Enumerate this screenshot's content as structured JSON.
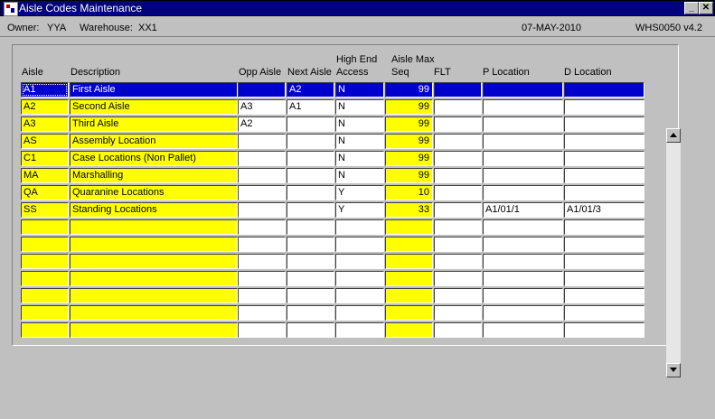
{
  "window": {
    "title": "Aisle Codes Maintenance",
    "minimize_glyph": "_",
    "close_glyph": "✕",
    "icon": "app-icon"
  },
  "header": {
    "owner_label": "Owner:",
    "owner": "YYA",
    "warehouse_label": "Warehouse:",
    "warehouse": "XX1",
    "date": "07-MAY-2010",
    "form_id": "WHS0050  v4.2"
  },
  "table": {
    "columns": {
      "aisle": "Aisle",
      "description": "Description",
      "opp_aisle": "Opp Aisle",
      "next_aisle": "Next Aisle",
      "high_end_1": "High End",
      "high_end_2": "Access",
      "aisle_max_1": "Aisle Max",
      "aisle_max_2": "Seq",
      "flt": "FLT",
      "p_location": "P Location",
      "d_location": "D Location"
    },
    "rows": [
      {
        "aisle": "A1",
        "description": "First Aisle",
        "opp_aisle": "",
        "next_aisle": "A2",
        "high_end": "N",
        "seq": "99",
        "flt": "",
        "p_location": "",
        "d_location": ""
      },
      {
        "aisle": "A2",
        "description": "Second Aisle",
        "opp_aisle": "A3",
        "next_aisle": "A1",
        "high_end": "N",
        "seq": "99",
        "flt": "",
        "p_location": "",
        "d_location": ""
      },
      {
        "aisle": "A3",
        "description": "Third Aisle",
        "opp_aisle": "A2",
        "next_aisle": "",
        "high_end": "N",
        "seq": "99",
        "flt": "",
        "p_location": "",
        "d_location": ""
      },
      {
        "aisle": "AS",
        "description": "Assembly Location",
        "opp_aisle": "",
        "next_aisle": "",
        "high_end": "N",
        "seq": "99",
        "flt": "",
        "p_location": "",
        "d_location": ""
      },
      {
        "aisle": "C1",
        "description": "Case Locations (Non Pallet)",
        "opp_aisle": "",
        "next_aisle": "",
        "high_end": "N",
        "seq": "99",
        "flt": "",
        "p_location": "",
        "d_location": ""
      },
      {
        "aisle": "MA",
        "description": "Marshalling",
        "opp_aisle": "",
        "next_aisle": "",
        "high_end": "N",
        "seq": "99",
        "flt": "",
        "p_location": "",
        "d_location": ""
      },
      {
        "aisle": "QA",
        "description": "Quaranine Locations",
        "opp_aisle": "",
        "next_aisle": "",
        "high_end": "Y",
        "seq": "10",
        "flt": "",
        "p_location": "",
        "d_location": ""
      },
      {
        "aisle": "SS",
        "description": "Standing Locations",
        "opp_aisle": "",
        "next_aisle": "",
        "high_end": "Y",
        "seq": "33",
        "flt": "",
        "p_location": "A1/01/1",
        "d_location": "A1/01/3"
      },
      {
        "aisle": "",
        "description": "",
        "opp_aisle": "",
        "next_aisle": "",
        "high_end": "",
        "seq": "",
        "flt": "",
        "p_location": "",
        "d_location": ""
      },
      {
        "aisle": "",
        "description": "",
        "opp_aisle": "",
        "next_aisle": "",
        "high_end": "",
        "seq": "",
        "flt": "",
        "p_location": "",
        "d_location": ""
      },
      {
        "aisle": "",
        "description": "",
        "opp_aisle": "",
        "next_aisle": "",
        "high_end": "",
        "seq": "",
        "flt": "",
        "p_location": "",
        "d_location": ""
      },
      {
        "aisle": "",
        "description": "",
        "opp_aisle": "",
        "next_aisle": "",
        "high_end": "",
        "seq": "",
        "flt": "",
        "p_location": "",
        "d_location": ""
      },
      {
        "aisle": "",
        "description": "",
        "opp_aisle": "",
        "next_aisle": "",
        "high_end": "",
        "seq": "",
        "flt": "",
        "p_location": "",
        "d_location": ""
      },
      {
        "aisle": "",
        "description": "",
        "opp_aisle": "",
        "next_aisle": "",
        "high_end": "",
        "seq": "",
        "flt": "",
        "p_location": "",
        "d_location": ""
      },
      {
        "aisle": "",
        "description": "",
        "opp_aisle": "",
        "next_aisle": "",
        "high_end": "",
        "seq": "",
        "flt": "",
        "p_location": "",
        "d_location": ""
      }
    ],
    "selected_row": 0
  },
  "colors": {
    "required_field": "#ffff00",
    "selection": "#0000cc",
    "title_bar": "#000080",
    "background": "#c0c0c0"
  }
}
